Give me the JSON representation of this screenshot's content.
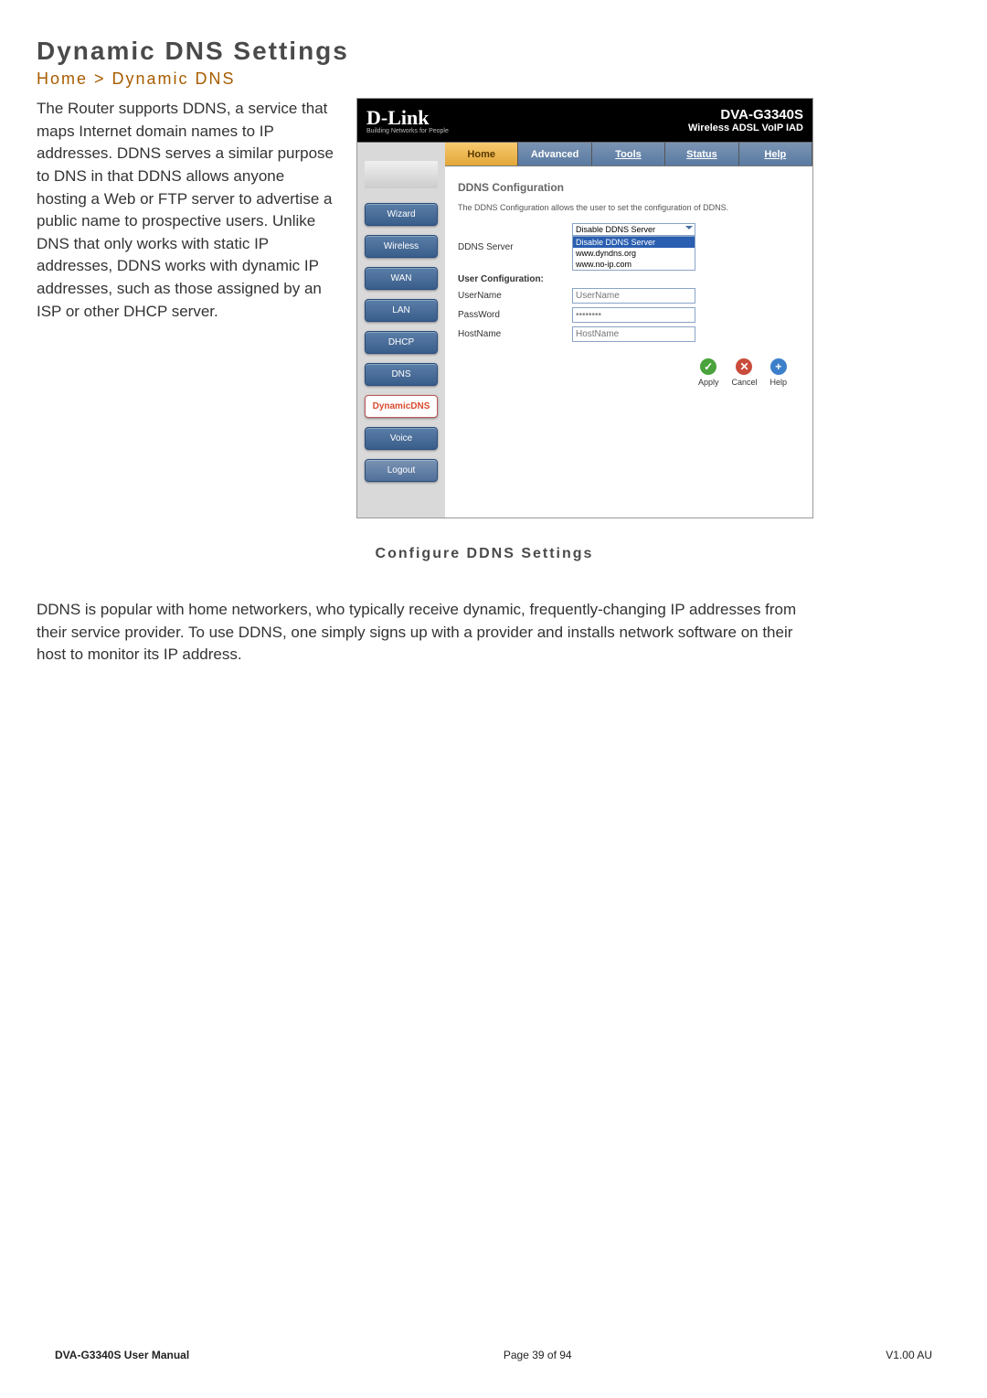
{
  "doc": {
    "title": "Dynamic DNS Settings",
    "breadcrumb": "Home > Dynamic DNS",
    "caption": "Configure DDNS Settings",
    "para1": "The Router supports DDNS, a service that maps Internet domain names to IP addresses. DDNS serves a similar purpose to DNS in that DDNS allows anyone hosting a Web or FTP server to advertise a public name to prospective users. Unlike DNS that only works with static IP addresses, DDNS works with dynamic IP addresses, such as those assigned by an ISP or other DHCP server.",
    "para2": "DDNS is popular with home networkers, who typically receive dynamic, frequently-changing IP addresses from their service provider. To use DDNS, one simply signs up with a provider and installs network software on their host to monitor its IP address."
  },
  "router": {
    "logo": {
      "brand": "D-Link",
      "tagline": "Building Networks for People"
    },
    "model": {
      "number": "DVA-G3340S",
      "desc": "Wireless ADSL VoIP IAD"
    },
    "tabs": {
      "home": "Home",
      "advanced": "Advanced",
      "tools": "Tools",
      "status": "Status",
      "help": "Help"
    },
    "sidebar": {
      "items": [
        "Wizard",
        "Wireless",
        "WAN",
        "LAN",
        "DHCP",
        "DNS",
        "DynamicDNS",
        "Voice",
        "Logout"
      ],
      "active": "DynamicDNS"
    },
    "section": {
      "title": "DDNS Configuration",
      "desc": "The DDNS Configuration allows the user to set the configuration of DDNS.",
      "form": {
        "ddns_server_label": "DDNS Server",
        "ddns_server_selected": "Disable DDNS Server",
        "ddns_server_options": [
          "Disable DDNS Server",
          "www.dyndns.org",
          "www.no-ip.com"
        ],
        "user_conf_label": "User Configuration:",
        "username_label": "UserName",
        "username_placeholder": "UserName",
        "password_label": "PassWord",
        "password_value": "••••••••",
        "hostname_label": "HostName",
        "hostname_placeholder": "HostName"
      },
      "actions": {
        "apply": "Apply",
        "cancel": "Cancel",
        "help": "Help"
      }
    }
  },
  "footer": {
    "manual": "DVA-G3340S User Manual",
    "page": "Page 39 of 94",
    "version": "V1.00 AU"
  }
}
